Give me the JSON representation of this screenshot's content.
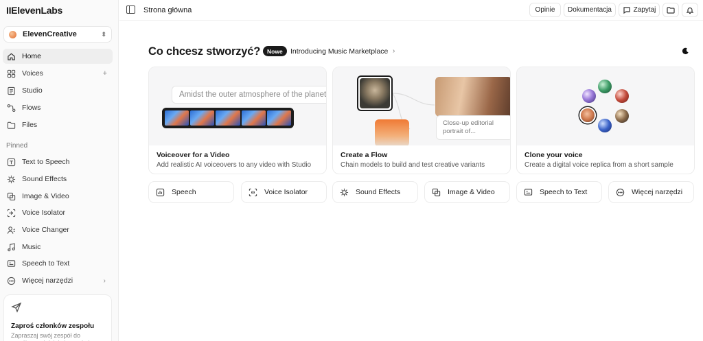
{
  "app": {
    "logo": "IIElevenLabs",
    "workspace": "ElevenCreative"
  },
  "nav": [
    {
      "id": "home",
      "label": "Home",
      "icon": "home-icon",
      "active": true
    },
    {
      "id": "voices",
      "label": "Voices",
      "icon": "voices-icon",
      "plus": true
    },
    {
      "id": "studio",
      "label": "Studio",
      "icon": "studio-icon"
    },
    {
      "id": "flows",
      "label": "Flows",
      "icon": "flows-icon"
    },
    {
      "id": "files",
      "label": "Files",
      "icon": "files-icon"
    }
  ],
  "pinned_label": "Pinned",
  "pinned": [
    {
      "id": "text-to-speech",
      "label": "Text to Speech",
      "icon": "text-to-speech-icon"
    },
    {
      "id": "sound-effects",
      "label": "Sound Effects",
      "icon": "sound-effects-icon"
    },
    {
      "id": "image-video",
      "label": "Image & Video",
      "icon": "image-video-icon"
    },
    {
      "id": "voice-isolator",
      "label": "Voice Isolator",
      "icon": "voice-isolator-icon"
    },
    {
      "id": "voice-changer",
      "label": "Voice Changer",
      "icon": "voice-changer-icon"
    },
    {
      "id": "music",
      "label": "Music",
      "icon": "music-icon"
    },
    {
      "id": "speech-to-text",
      "label": "Speech to Text",
      "icon": "speech-to-text-icon"
    },
    {
      "id": "more-tools",
      "label": "Więcej narzędzi",
      "icon": "more-tools-icon",
      "chevron": true
    }
  ],
  "invite": {
    "title": "Zaproś członków zespołu",
    "desc": "Zapraszaj swój zespół do współpracy i dziel się swoimi"
  },
  "topbar": {
    "page_title": "Strona główna",
    "feedback": "Opinie",
    "docs": "Dokumentacja",
    "ask": "Zapytaj"
  },
  "main": {
    "heading": "Co chcesz stworzyć?",
    "badge": "Nowe",
    "intro": "Introducing Music Marketplace",
    "cards": [
      {
        "title": "Voiceover for a Video",
        "desc": "Add realistic AI voiceovers to any video with Studio",
        "sample_text": "Amidst the outer atmosphere of the planet"
      },
      {
        "title": "Create a Flow",
        "desc": "Chain models to build and test creative variants",
        "callout": "Close-up editorial portrait of..."
      },
      {
        "title": "Clone your voice",
        "desc": "Create a digital voice replica from a short sample"
      }
    ],
    "tools": [
      {
        "label": "Speech",
        "icon": "speech-icon"
      },
      {
        "label": "Voice Isolator",
        "icon": "voice-isolator-icon"
      },
      {
        "label": "Sound Effects",
        "icon": "sound-effects-icon"
      },
      {
        "label": "Image & Video",
        "icon": "image-video-icon"
      },
      {
        "label": "Speech to Text",
        "icon": "speech-to-text-icon"
      },
      {
        "label": "Więcej narzędzi",
        "icon": "more-tools-icon"
      }
    ]
  }
}
